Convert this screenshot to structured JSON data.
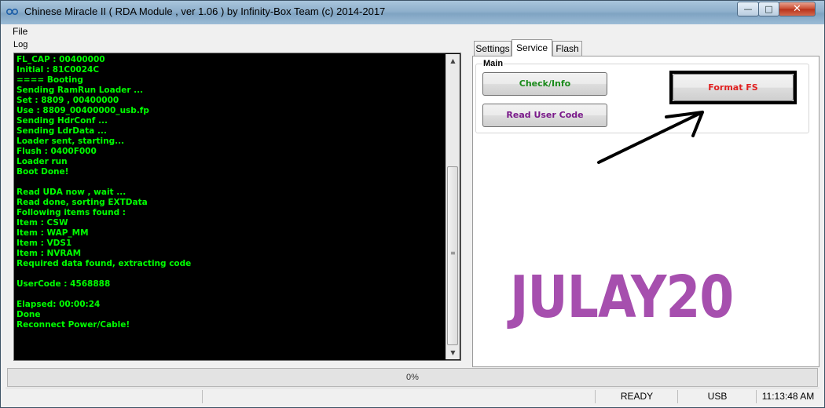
{
  "window": {
    "title": "Chinese Miracle II ( RDA Module , ver 1.06 ) by Infinity-Box Team (c) 2014-2017",
    "minimize_glyph": "—",
    "maximize_glyph": "□",
    "close_glyph": "✕"
  },
  "menu": {
    "file": "File"
  },
  "log": {
    "label": "Log",
    "lines": [
      "FL_CAP : 00400000",
      "Initial : 81C0024C",
      "==== Booting",
      "Sending RamRun Loader ...",
      "Set : 8809 , 00400000",
      "Use : 8809_00400000_usb.fp",
      "Sending HdrConf ...",
      "Sending LdrData ...",
      "Loader sent, starting...",
      "Flush : 0400F000",
      "Loader run",
      "Boot Done!",
      "",
      "Read UDA now , wait ...",
      "Read done, sorting EXTData",
      "Following items found :",
      "Item : CSW",
      "Item : WAP_MM",
      "Item : VDS1",
      "Item : NVRAM",
      "Required data found, extracting code",
      "",
      "UserCode : 4568888",
      "",
      "Elapsed: 00:00:24",
      "Done",
      "Reconnect Power/Cable!"
    ]
  },
  "tabs": {
    "settings": "Settings",
    "service": "Service",
    "flash": "Flash"
  },
  "main_group": {
    "label": "Main",
    "check_info": "Check/Info",
    "read_user_code": "Read User Code",
    "format_fs": "Format FS"
  },
  "watermark": "JULAY20",
  "progress": {
    "text": "0%",
    "value": 0
  },
  "status": {
    "ready": "READY",
    "usb": "USB",
    "time": "11:13:48 AM"
  },
  "colors": {
    "log_text": "#00ff00",
    "check_info": "#1a8a1a",
    "read_user_code": "#7a1a8a",
    "format_fs": "#e02020",
    "watermark": "#a64fae"
  }
}
